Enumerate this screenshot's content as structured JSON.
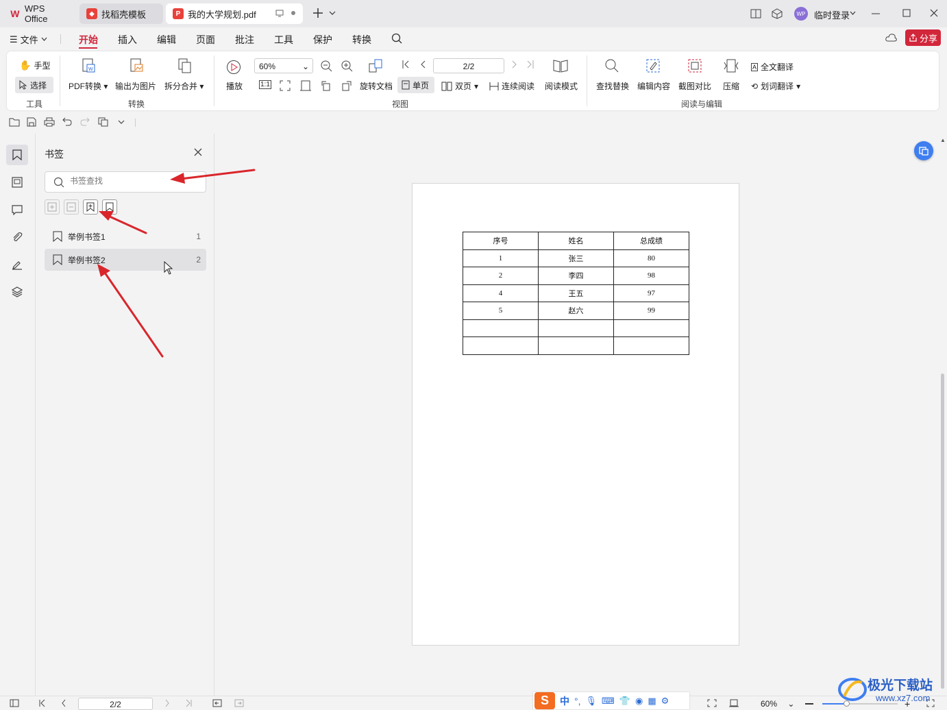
{
  "titlebar": {
    "tabs": [
      {
        "label": "WPS Office"
      },
      {
        "label": "找稻壳模板"
      },
      {
        "label": "我的大学规划.pdf"
      }
    ],
    "user_label": "临时登录",
    "avatar_text": "WP"
  },
  "menu": {
    "file_label": "文件",
    "items": [
      "开始",
      "插入",
      "编辑",
      "页面",
      "批注",
      "工具",
      "保护",
      "转换"
    ],
    "share_label": "分享"
  },
  "ribbon": {
    "hand_label": "手型",
    "select_label": "选择",
    "group_tools": "工具",
    "pdf_convert": "PDF转换",
    "export_image": "输出为图片",
    "split_merge": "拆分合并",
    "group_convert": "转换",
    "play_label": "播放",
    "zoom_value": "60%",
    "page_value": "2/2",
    "rotate_label": "旋转文档",
    "single_label": "单页",
    "double_label": "双页",
    "continuous_label": "连续阅读",
    "reading_mode": "阅读模式",
    "group_view": "视图",
    "find_replace": "查找替换",
    "edit_content": "编辑内容",
    "screenshot_compare": "截图对比",
    "compress": "压缩",
    "full_translate": "全文翻译",
    "word_translate": "划词翻译",
    "group_read_edit": "阅读与编辑"
  },
  "panel": {
    "title": "书签",
    "search_placeholder": "书签查找",
    "bookmarks": [
      {
        "label": "举例书签1",
        "page": "1"
      },
      {
        "label": "举例书签2",
        "page": "2"
      }
    ]
  },
  "document": {
    "headers": [
      "序号",
      "姓名",
      "总成绩"
    ],
    "rows": [
      [
        "1",
        "张三",
        "80"
      ],
      [
        "2",
        "李四",
        "98"
      ],
      [
        "4",
        "王五",
        "97"
      ],
      [
        "5",
        "赵六",
        "99"
      ],
      [
        "",
        "",
        ""
      ],
      [
        "",
        "",
        ""
      ]
    ]
  },
  "status": {
    "page_value": "2/2",
    "zoom_value": "60%"
  },
  "ime": {
    "chinese_label": "中"
  },
  "watermark": {
    "text": "极光下载站",
    "url": "www.xz7.com"
  },
  "colors": {
    "accent": "#d2263b",
    "annotation_arrow": "#d9262b",
    "float_button": "#3e7ef0"
  }
}
